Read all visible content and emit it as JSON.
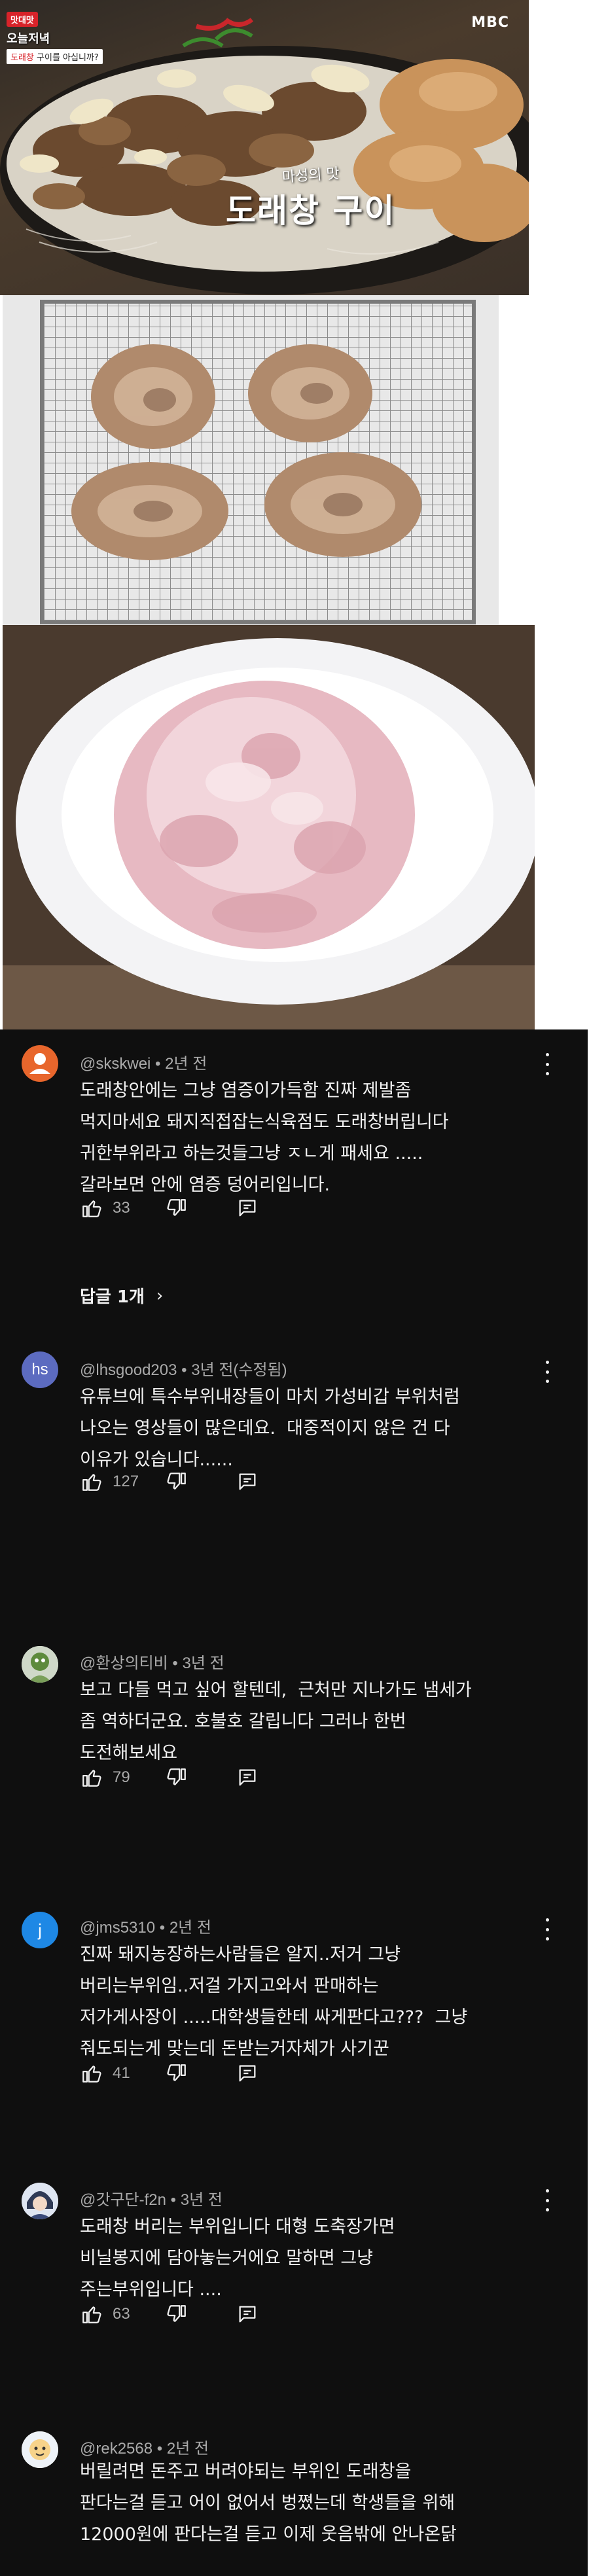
{
  "photos": {
    "top": {
      "broadcaster": "MBC",
      "show_name": "오늘저녁",
      "brand_tag": "맛대맛",
      "subtitle_pre": "",
      "subtitle_highlight": "도래창",
      "subtitle_post": " 구이를 아십니까?",
      "caption_small": "마성의 맛",
      "caption_big": "도래창 구이"
    }
  },
  "comments": [
    {
      "author": "@skskwei",
      "time": "2년 전",
      "text": "도래창안에는 그냥 염증이가득함 진짜 제발좀\n먹지마세요 돼지직접잡는식육점도 도래창버립니다\n귀한부위라고 하는것들그냥 ㅈㄴ게 패세요 .....\n갈라보면 안에 염증 덩어리입니다.",
      "likes": "33",
      "avatar_letter": "",
      "avatar_color": "#e8662c",
      "avatar_icon": "person-icon",
      "replies_label": "답글 1개"
    },
    {
      "author": "@lhsgood203",
      "time": "3년 전(수정됨)",
      "text": "유튜브에 특수부위내장들이 마치 가성비갑 부위처럼\n나오는 영상들이 많은데요.  대중적이지 않은 건 다\n이유가 있습니다......",
      "likes": "127",
      "avatar_letter": "hs",
      "avatar_color": "#5c6bc0",
      "avatar_icon": "",
      "replies_label": ""
    },
    {
      "author": "@환상의티비",
      "time": "3년 전",
      "text": "보고 다들 먹고 싶어 할텐데,  근처만 지나가도 냄세가\n좀 역하더군요. 호불호 갈립니다 그러나 한번\n도전해보세요",
      "likes": "79",
      "avatar_letter": "",
      "avatar_color": "#d7d7d7",
      "avatar_icon": "character-icon",
      "replies_label": ""
    },
    {
      "author": "@jms5310",
      "time": "2년 전",
      "text": "진짜 돼지농장하는사람들은 알지..저거 그냥\n버리는부위임..저걸 가지고와서 판매하는\n저가게사장이 .....대학생들한테 싸게판다고???  그냥\n줘도되는게 맞는데 돈받는거자체가 사기꾼",
      "likes": "41",
      "avatar_letter": "j",
      "avatar_color": "#1e88e5",
      "avatar_icon": "",
      "replies_label": ""
    },
    {
      "author": "@갓구단-f2n",
      "time": "3년 전",
      "text": "도래창 버리는 부위입니다 대형 도축장가면\n비닐봉지에 담아놓는거에요 말하면 그냥\n주는부위입니다 ....",
      "likes": "63",
      "avatar_letter": "",
      "avatar_color": "#c9d6e8",
      "avatar_icon": "anime-avatar-icon",
      "replies_label": ""
    },
    {
      "author": "@rek2568",
      "time": "2년 전",
      "text": "버릴려면 돈주고 버려야되는 부위인 도래창을\n판다는걸 듣고 어이 없어서 벙쪘는데 학생들을 위해\n12000원에 판다는걸 듣고 이제 웃음밖에 안나온닭",
      "likes": "",
      "avatar_letter": "",
      "avatar_color": "#f4e6c8",
      "avatar_icon": "cartoon-avatar-icon",
      "replies_label": ""
    }
  ]
}
